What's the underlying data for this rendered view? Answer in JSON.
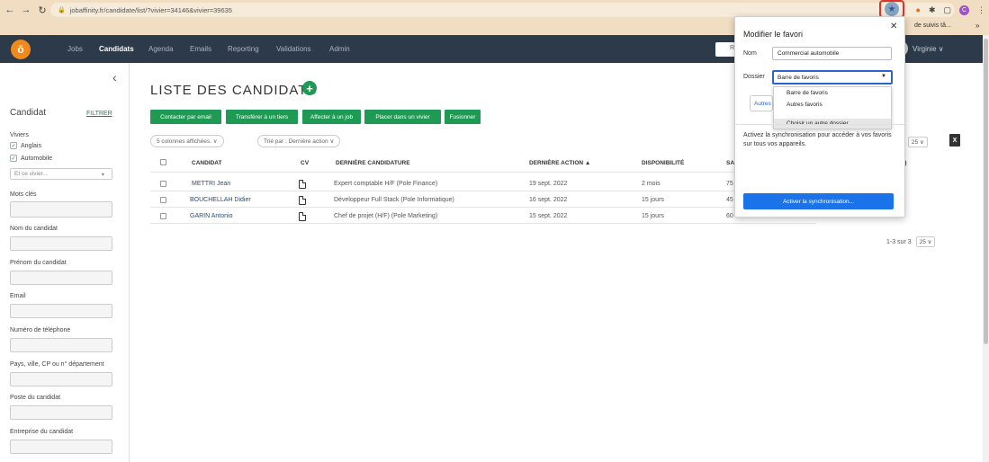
{
  "browser": {
    "url": "jobaffinity.fr/candidate/list/?vivier=34146&vivier=39635",
    "bookmark_partial": "de suivis tâ...",
    "profile_initial": "C"
  },
  "topnav": {
    "logo": "ö",
    "items": [
      {
        "label": "Jobs"
      },
      {
        "label": "Candidats"
      },
      {
        "label": "Agenda"
      },
      {
        "label": "Emails"
      },
      {
        "label": "Reporting"
      },
      {
        "label": "Validations"
      },
      {
        "label": "Admin"
      }
    ],
    "search_stub": "R",
    "user": "Virginie ∨"
  },
  "sidebar": {
    "title": "Candidat",
    "filter": "FILTRER",
    "viviers_label": "Viviers",
    "viviers": [
      "Anglais",
      "Automobile"
    ],
    "vivier_select_placeholder": "Et ce vivier...",
    "fields": [
      "Mots clés",
      "Nom du candidat",
      "Prénom du candidat",
      "Email",
      "Numéro de téléphone",
      "Pays, ville, CP ou n° département",
      "Poste du candidat",
      "Entreprise du candidat"
    ]
  },
  "main": {
    "title": "LISTE DES CANDIDATS",
    "actions": [
      "Contacter par email",
      "Transférer à un tiers",
      "Affecter à un job",
      "Placer dans un vivier",
      "Fusionner"
    ],
    "columns_pill": "5 colonnes affichées. ∨",
    "sort_pill": "Trié par : Dernière action ∨",
    "headers": [
      "CANDIDAT",
      "CV",
      "DERNIÈRE CANDIDATURE",
      "DERNIÈRE ACTION ▲",
      "DISPONIBILITÉ",
      "SA",
      "S)"
    ],
    "rows": [
      {
        "name": "METTRI Jean",
        "candidature": "Expert comptable H/F (Pole Finance)",
        "action": "19 sept. 2022",
        "dispo": "2 mois",
        "salary": "75"
      },
      {
        "name": "BOUCHELLAH Didier",
        "candidature": "Développeur Full Stack (Pole Informatique)",
        "action": "16 sept. 2022",
        "dispo": "15 jours",
        "salary": "45"
      },
      {
        "name": "GARIN Antonio",
        "candidature": "Chef de projet (H/F) (Pole Marketing)",
        "action": "15 sept. 2022",
        "dispo": "15 jours",
        "salary": "60 000 €"
      }
    ],
    "pager_top": "3",
    "pager_bottom": "1-3 sur 3",
    "per_page": "25 ∨",
    "excel": "X"
  },
  "bookmark_popup": {
    "title": "Modifier le favori",
    "close": "✕",
    "nom_label": "Nom",
    "nom_value": "Commercial automobile",
    "dossier_label": "Dossier",
    "dossier_value": "Barre de favoris",
    "options": [
      "Barre de favoris",
      "Autres favoris",
      "Choisir un autre dossier..."
    ],
    "partial_btn": "Autres",
    "sync_text": "Activez la synchronisation pour accéder à vos favoris sur tous vos appareils.",
    "sync_button": "Activer la synchronisation..."
  },
  "colors": {
    "accent_green": "#1e9a55",
    "nav_bg": "#2d3a4a",
    "chrome_bg": "#f0ddc2",
    "highlight_red": "#e03030",
    "google_blue": "#1a73e8"
  }
}
